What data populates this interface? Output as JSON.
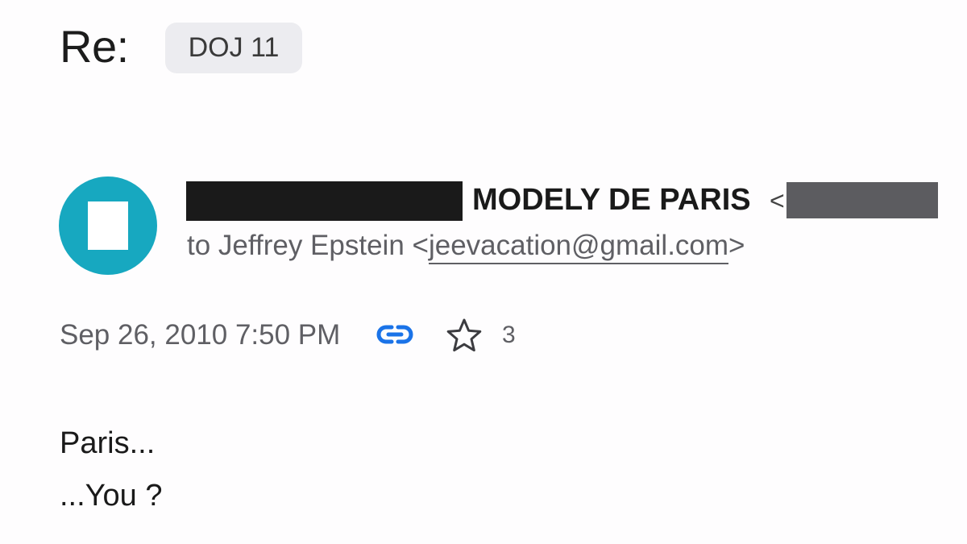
{
  "subject": {
    "prefix": "Re:",
    "label": "DOJ 11"
  },
  "sender": {
    "name": "MODELY DE PARIS",
    "lt": "<"
  },
  "recipient": {
    "prefix": "to Jeffrey Epstein <",
    "email": "jeevacation@gmail.com",
    "suffix": ">"
  },
  "meta": {
    "date": "Sep 26, 2010 7:50 PM",
    "star_count": "3",
    "link_icon": "link-icon",
    "star_icon": "star-outline-icon",
    "link_color": "#1a73e8"
  },
  "body": {
    "lines": [
      "Paris...",
      "...You ?"
    ]
  },
  "colors": {
    "avatar": "#17a8c0",
    "chip_bg": "#ececf0",
    "redaction_dark": "#1a1a1a",
    "redaction_gray": "#5c5c60"
  }
}
